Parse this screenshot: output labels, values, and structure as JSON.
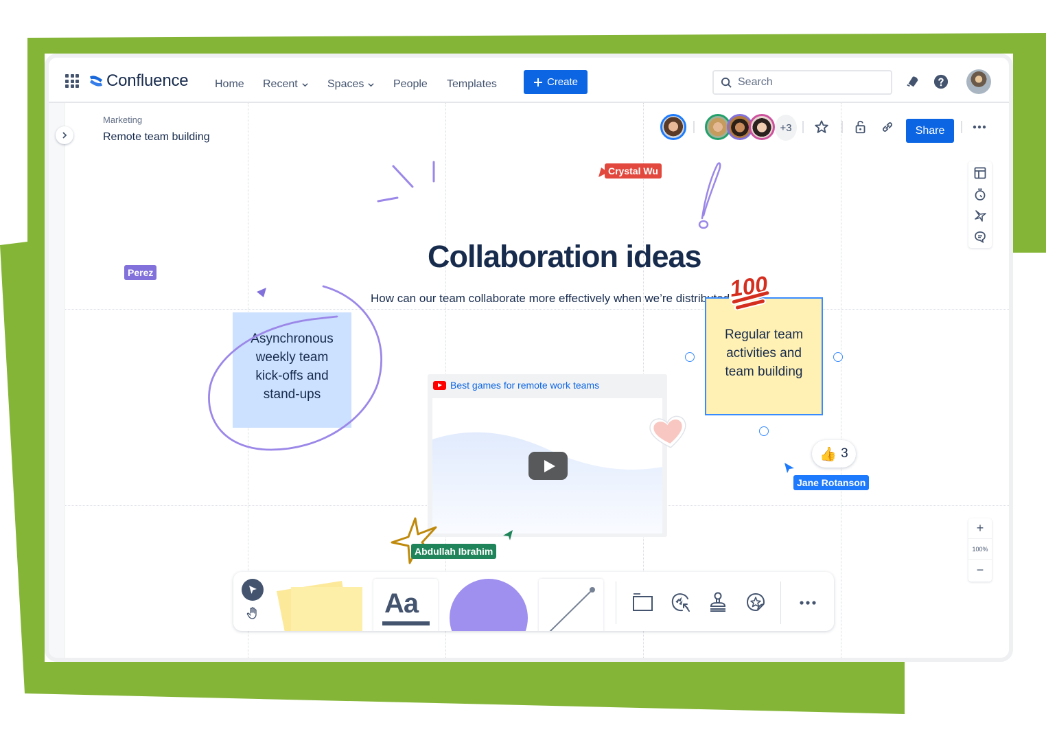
{
  "app": {
    "name": "Confluence"
  },
  "nav": {
    "items": [
      {
        "label": "Home",
        "has_dropdown": false
      },
      {
        "label": "Recent",
        "has_dropdown": true
      },
      {
        "label": "Spaces",
        "has_dropdown": true
      },
      {
        "label": "People",
        "has_dropdown": false
      },
      {
        "label": "Templates",
        "has_dropdown": false
      }
    ],
    "create_label": "Create",
    "search_placeholder": "Search",
    "icons": [
      "apps-grid-icon",
      "notifications-bell-icon",
      "help-icon",
      "profile-avatar"
    ]
  },
  "page": {
    "space": "Marketing",
    "title": "Remote team building"
  },
  "header_actions": {
    "extra_collaborators": "+3",
    "share_label": "Share",
    "icons": [
      "star-icon",
      "lock-open-icon",
      "link-icon",
      "more-icon"
    ]
  },
  "whiteboard": {
    "title": "Collaboration ideas",
    "subtitle": "How can our team collaborate more effectively when we’re distributed?",
    "cursors": [
      {
        "name": "Crystal Wu",
        "color": "#e2483d"
      },
      {
        "name": "Perez",
        "color": "#8270db"
      },
      {
        "name": "Jane Rotanson",
        "color": "#1d7afc"
      },
      {
        "name": "Abdullah Ibrahim",
        "color": "#1f845a"
      }
    ],
    "stickies": [
      {
        "text": "Asynchronous weekly team kick-offs and stand-ups",
        "color": "#cce0ff"
      },
      {
        "text": "Regular team activities and team building",
        "color": "#fff0b3"
      }
    ],
    "video": {
      "title": "Best games for remote work teams"
    },
    "reaction": {
      "emoji": "👍",
      "count": "3"
    },
    "stickers": [
      "hundred-points-sticker",
      "heart-sticker",
      "star-doodle"
    ]
  },
  "side_tools": [
    "templates-icon",
    "timer-icon",
    "pin-icon",
    "comment-icon"
  ],
  "zoom": {
    "level": "100%",
    "plus": "+",
    "minus": "−"
  },
  "toolbar": {
    "text_tool_label": "Aa",
    "tools": [
      "select-tool",
      "hand-tool",
      "sticky-note-tool",
      "text-tool",
      "shape-tool",
      "line-tool",
      "frame-tool",
      "emoji-reaction-tool",
      "stamp-tool",
      "sticker-tool",
      "more-tools"
    ]
  },
  "colors": {
    "brand_green": "#84b537",
    "primary_blue": "#0c66e4",
    "text_dark": "#172b4d"
  }
}
